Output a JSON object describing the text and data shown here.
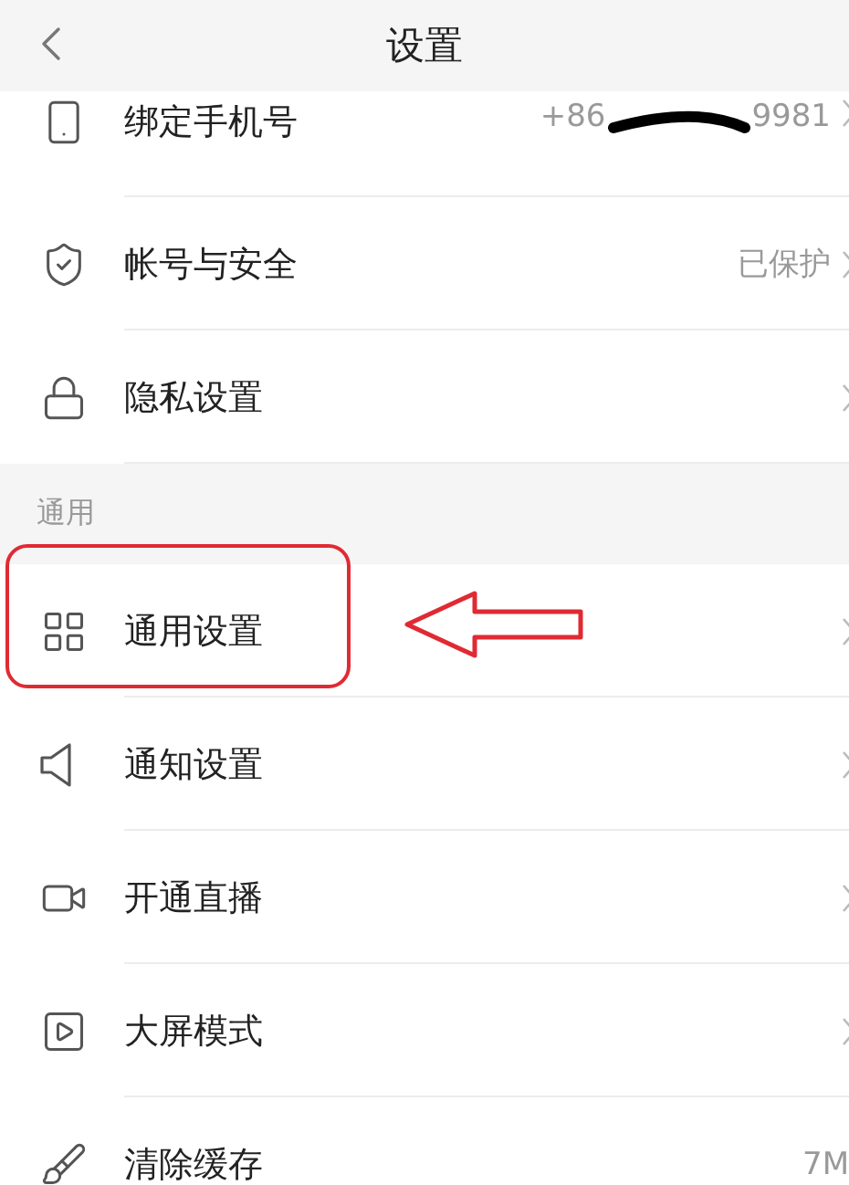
{
  "header": {
    "title": "设置"
  },
  "groups": [
    {
      "rows": [
        {
          "label": "绑定手机号",
          "value_prefix": "+86",
          "value_suffix": "9981",
          "highlighted": false
        },
        {
          "label": "帐号与安全",
          "value": "已保护",
          "highlighted": false
        },
        {
          "label": "隐私设置",
          "highlighted": false
        }
      ]
    },
    {
      "title": "通用",
      "rows": [
        {
          "label": "通用设置",
          "highlighted": true
        },
        {
          "label": "通知设置",
          "highlighted": false
        },
        {
          "label": "开通直播",
          "highlighted": false
        },
        {
          "label": "大屏模式",
          "highlighted": false
        },
        {
          "label": "清除缓存",
          "value": "7M",
          "highlighted": false
        }
      ]
    }
  ]
}
